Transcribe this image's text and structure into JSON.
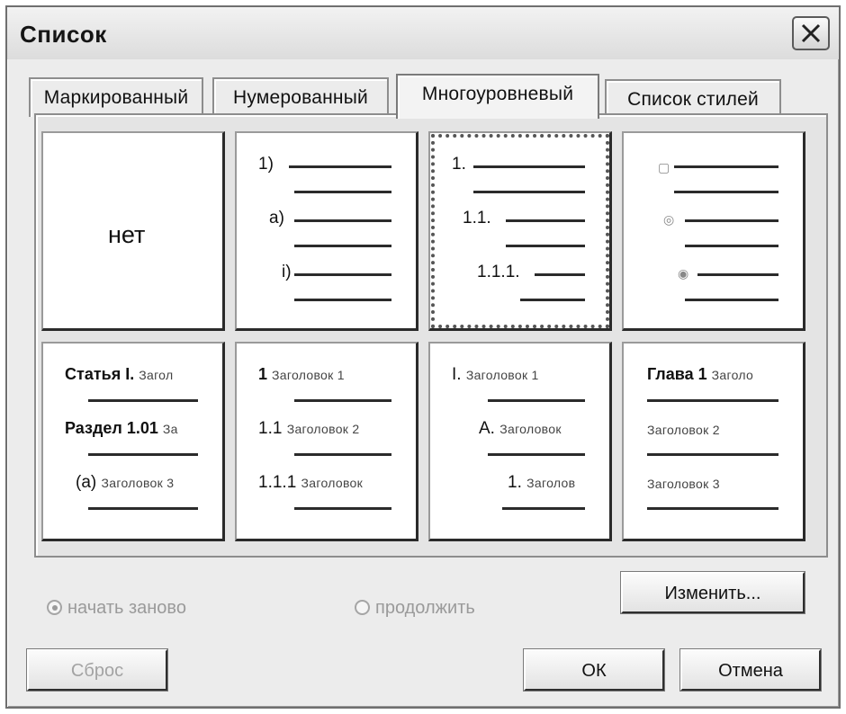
{
  "window": {
    "title": "Список"
  },
  "tabs": [
    {
      "label": "Маркированный",
      "active": false
    },
    {
      "label": "Нумерованный",
      "active": false
    },
    {
      "label": "Многоуровневый",
      "active": true
    },
    {
      "label": "Список стилей",
      "active": false
    }
  ],
  "gallery": {
    "none_label": "нет",
    "cell2": [
      "1)",
      "a)",
      "i)"
    ],
    "cell3": [
      "1.",
      "1.1.",
      "1.1.1."
    ],
    "cell5": {
      "l1": "Статья I.",
      "l1s": "Загол",
      "l2": "Раздел 1.01",
      "l2s": "За",
      "l3": "(а)",
      "l3s": "Заголовок 3"
    },
    "cell6": {
      "l1": "1",
      "l1s": "Заголовок 1",
      "l2": "1.1",
      "l2s": "Заголовок 2",
      "l3": "1.1.1",
      "l3s": "Заголовок"
    },
    "cell7": {
      "l1": "I.",
      "l1s": "Заголовок 1",
      "l2": "А.",
      "l2s": "Заголовок",
      "l3": "1.",
      "l3s": "Заголов"
    },
    "cell8": {
      "l1": "Глава 1",
      "l1s": "Заголо",
      "l2": "Заголовок 2",
      "l3": "Заголовок 3"
    }
  },
  "options": {
    "restart_label": "начать заново",
    "continue_label": "продолжить"
  },
  "buttons": {
    "change": "Изменить...",
    "reset": "Сброс",
    "ok": "ОК",
    "cancel": "Отмена"
  }
}
